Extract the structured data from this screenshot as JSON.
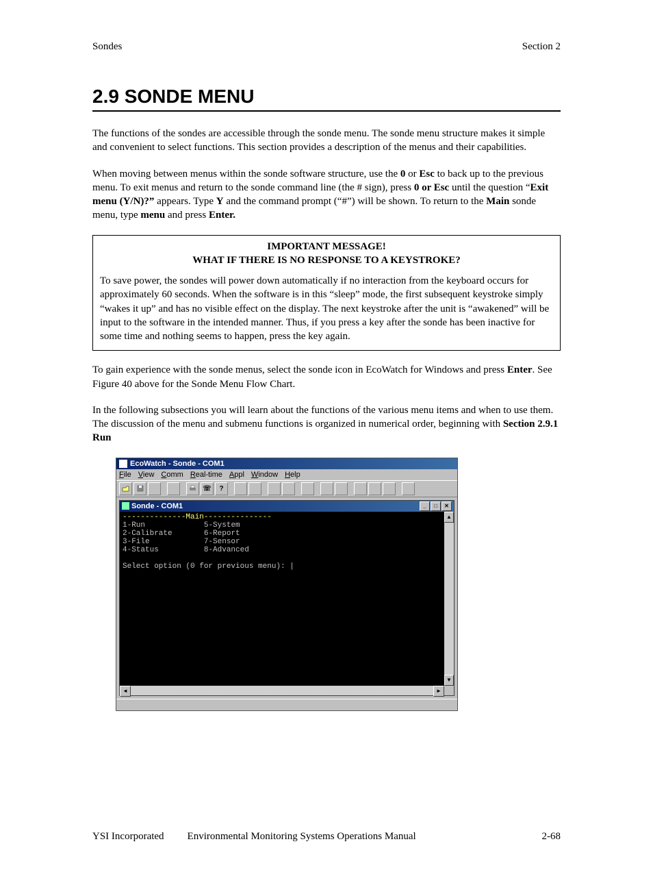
{
  "header": {
    "left": "Sondes",
    "right": "Section 2"
  },
  "heading": "2.9  SONDE MENU",
  "p1": "The functions of the sondes are accessible through the sonde menu.  The sonde menu structure makes it simple and convenient to select functions.  This section provides a description of the menus and their capabilities.",
  "p2": {
    "t1": "When moving between menus within the sonde software structure, use the ",
    "b1": "0",
    "t2": " or ",
    "b2": "Esc",
    "t3": " to back up to the previous menu.  To exit menus and return to the sonde command line (the # sign), press ",
    "b3": "0 or Esc",
    "t4": " until the question “",
    "b4": "Exit menu (Y/N)?”",
    "t5": " appears.   Type ",
    "b5": "Y",
    "t6": " and the command prompt (“#”) will be shown. To return to the ",
    "b6": "Main",
    "t7": " sonde menu, type ",
    "b7": "menu",
    "t8": " and press ",
    "b8": "Enter."
  },
  "box": {
    "title1": "IMPORTANT MESSAGE!",
    "title2": "WHAT IF THERE IS NO RESPONSE TO A KEYSTROKE?",
    "body": "To save power, the sondes will power down automatically if no interaction from the keyboard occurs for approximately 60 seconds.   When the software is in this “sleep” mode, the first subsequent keystroke simply “wakes it up” and has no visible effect on the display.  The next keystroke after the unit is “awakened” will be input to the software in the intended manner.   Thus, if you press a key after the sonde has been inactive for some time and nothing seems to happen, press the key again."
  },
  "p3": {
    "t1": "To gain experience with the sonde menus, select the sonde icon in EcoWatch for Windows and press ",
    "b1": "Enter",
    "t2": ". See Figure 40 above for the Sonde Menu Flow Chart."
  },
  "p4": {
    "t1": "In the following subsections you will learn about the functions of the various menu items and when to use them.  The discussion of the menu and submenu functions is organized in numerical order, beginning with ",
    "b1": "Section 2.9.1 Run"
  },
  "ecowatch": {
    "title": "EcoWatch - Sonde - COM1",
    "menus": [
      "File",
      "View",
      "Comm",
      "Real-time",
      "Appl",
      "Window",
      "Help"
    ],
    "inner_title": "Sonde - COM1",
    "window_controls": {
      "min": "_",
      "max": "□",
      "close": "✕"
    },
    "terminal": {
      "rule_label": "Main",
      "items_left": [
        "1-Run",
        "2-Calibrate",
        "3-File",
        "4-Status"
      ],
      "items_right": [
        "5-System",
        "6-Report",
        "7-Sensor",
        "8-Advanced"
      ],
      "prompt": "Select option (0 for previous menu): |"
    },
    "scroll": {
      "up": "▲",
      "down": "▼",
      "left": "◄",
      "right": "►"
    }
  },
  "footer": {
    "company": "YSI Incorporated",
    "manual": "Environmental Monitoring Systems Operations Manual",
    "page": "2-68"
  }
}
